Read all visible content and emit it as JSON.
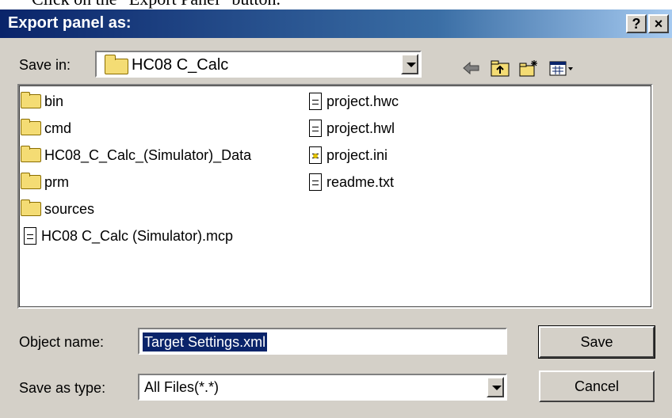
{
  "caption": "Click on the “Export Panel” button.",
  "window": {
    "title": "Export panel as:",
    "help_label": "?",
    "close_label": "×"
  },
  "save_in": {
    "label": "Save in:",
    "value": "HC08 C_Calc"
  },
  "files": {
    "col1": [
      {
        "name": "bin",
        "icon": "folder-icon"
      },
      {
        "name": "cmd",
        "icon": "folder-icon"
      },
      {
        "name": "HC08_C_Calc_(Simulator)_Data",
        "icon": "folder-icon"
      },
      {
        "name": "prm",
        "icon": "folder-icon"
      },
      {
        "name": "sources",
        "icon": "folder-icon"
      },
      {
        "name": "HC08 C_Calc (Simulator).mcp",
        "icon": "document-icon"
      }
    ],
    "col2": [
      {
        "name": "project.hwc",
        "icon": "document-icon"
      },
      {
        "name": "project.hwl",
        "icon": "document-icon"
      },
      {
        "name": "project.ini",
        "icon": "settings-document-icon"
      },
      {
        "name": "readme.txt",
        "icon": "document-icon"
      }
    ]
  },
  "object_name": {
    "label": "Object name:",
    "value": "Target Settings.xml"
  },
  "save_as_type": {
    "label": "Save as type:",
    "value": "All Files(*.*)"
  },
  "buttons": {
    "save": "Save",
    "cancel": "Cancel"
  },
  "toolbar_icons": [
    "back-arrow-icon",
    "up-folder-icon",
    "new-folder-icon",
    "view-menu-icon"
  ]
}
